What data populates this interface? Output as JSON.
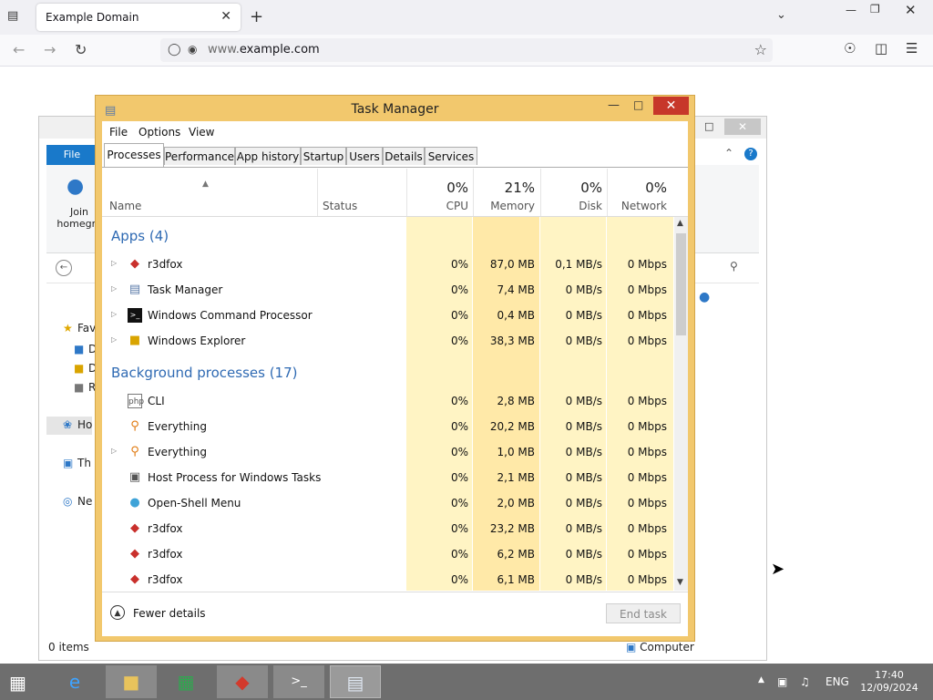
{
  "browser": {
    "tab_title": "Example Domain",
    "url_prefix": "www.",
    "url_domain": "example.com"
  },
  "explorer": {
    "ribbon_tab": "File",
    "join_label_1": "Join",
    "join_label_2": "homegro",
    "nav": [
      {
        "label": "Fav",
        "icon": "star-icon"
      },
      {
        "label": "D",
        "icon": "folder-icon"
      },
      {
        "label": "D",
        "icon": "folder-icon"
      },
      {
        "label": "R",
        "icon": "folder-icon"
      },
      {
        "label": "Ho",
        "icon": "homegroup-icon"
      },
      {
        "label": "Th",
        "icon": "computer-icon"
      },
      {
        "label": "Ne",
        "icon": "network-icon"
      }
    ],
    "status_items": "0 items",
    "status_computer": "Computer"
  },
  "taskmanager": {
    "title": "Task Manager",
    "menu": [
      "File",
      "Options",
      "View"
    ],
    "tabs": [
      "Processes",
      "Performance",
      "App history",
      "Startup",
      "Users",
      "Details",
      "Services"
    ],
    "header": {
      "name": "Name",
      "status": "Status",
      "cpu_pct": "0%",
      "cpu": "CPU",
      "mem_pct": "21%",
      "mem": "Memory",
      "disk_pct": "0%",
      "disk": "Disk",
      "net_pct": "0%",
      "net": "Network"
    },
    "groups": {
      "apps": "Apps (4)",
      "background": "Background processes (17)"
    },
    "apps": [
      {
        "name": "r3dfox",
        "icon": "r3dfox-icon",
        "cpu": "0%",
        "mem": "87,0 MB",
        "disk": "0,1 MB/s",
        "net": "0 Mbps"
      },
      {
        "name": "Task Manager",
        "icon": "taskmanager-icon",
        "cpu": "0%",
        "mem": "7,4 MB",
        "disk": "0 MB/s",
        "net": "0 Mbps"
      },
      {
        "name": "Windows Command Processor",
        "icon": "cmd-icon",
        "cpu": "0%",
        "mem": "0,4 MB",
        "disk": "0 MB/s",
        "net": "0 Mbps"
      },
      {
        "name": "Windows Explorer",
        "icon": "explorer-icon",
        "cpu": "0%",
        "mem": "38,3 MB",
        "disk": "0 MB/s",
        "net": "0 Mbps"
      }
    ],
    "background": [
      {
        "name": "CLI",
        "icon": "php-icon",
        "cpu": "0%",
        "mem": "2,8 MB",
        "disk": "0 MB/s",
        "net": "0 Mbps"
      },
      {
        "name": "Everything",
        "icon": "everything-icon",
        "cpu": "0%",
        "mem": "20,2 MB",
        "disk": "0 MB/s",
        "net": "0 Mbps"
      },
      {
        "name": "Everything",
        "icon": "everything-icon",
        "cpu": "0%",
        "mem": "1,0 MB",
        "disk": "0 MB/s",
        "net": "0 Mbps"
      },
      {
        "name": "Host Process for Windows Tasks",
        "icon": "hostprocess-icon",
        "cpu": "0%",
        "mem": "2,1 MB",
        "disk": "0 MB/s",
        "net": "0 Mbps"
      },
      {
        "name": "Open-Shell Menu",
        "icon": "openshell-icon",
        "cpu": "0%",
        "mem": "2,0 MB",
        "disk": "0 MB/s",
        "net": "0 Mbps"
      },
      {
        "name": "r3dfox",
        "icon": "r3dfox-icon",
        "cpu": "0%",
        "mem": "23,2 MB",
        "disk": "0 MB/s",
        "net": "0 Mbps"
      },
      {
        "name": "r3dfox",
        "icon": "r3dfox-icon",
        "cpu": "0%",
        "mem": "6,2 MB",
        "disk": "0 MB/s",
        "net": "0 Mbps"
      },
      {
        "name": "r3dfox",
        "icon": "r3dfox-icon",
        "cpu": "0%",
        "mem": "6,1 MB",
        "disk": "0 MB/s",
        "net": "0 Mbps"
      }
    ],
    "fewer_details": "Fewer details",
    "end_task": "End task"
  },
  "taskbar": {
    "language": "ENG",
    "time": "17:40",
    "date": "12/09/2024"
  }
}
